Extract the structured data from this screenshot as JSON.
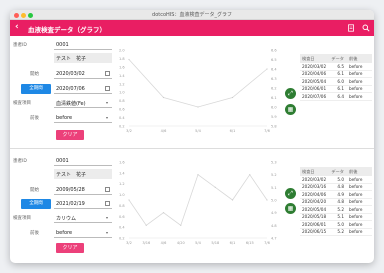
{
  "window": {
    "title": "dotcoHIS：血液検査データ_グラフ"
  },
  "appbar": {
    "back_icon": "chevron-left",
    "title": "血液検査データ（グラフ）",
    "icon1": "document-icon",
    "icon2": "zoom-icon"
  },
  "labels": {
    "patient_id": "患者ID",
    "start": "開始",
    "end_btn": "全期間",
    "item": "検査項目",
    "timing": "前後",
    "clear": "クリア"
  },
  "panel1": {
    "patient_id": "0001",
    "patient_name": "テスト　花子",
    "start_date": "2020/03/02",
    "end_date": "2020/07/06",
    "item": "血清鉄値(Fe)",
    "timing": "before",
    "chart_data": {
      "type": "line",
      "x": [
        "3/2",
        "4/6",
        "5/4",
        "6/1",
        "7/6"
      ],
      "y": [
        6.5,
        6.1,
        6.0,
        6.1,
        6.4
      ],
      "left_ticks": [
        "2.0",
        "1.8",
        "1.6",
        "1.4",
        "1.2",
        "1.0",
        "0.8",
        "0.6",
        "0.4",
        "0.2"
      ],
      "right_ticks": [
        "6.6",
        "6.5",
        "6.4",
        "6.3",
        "6.2",
        "6.1",
        "6.0",
        "5.9",
        "5.8"
      ],
      "x_ticks": [
        "3/2",
        "4/6",
        "5/4",
        "6/1",
        "7/6"
      ],
      "ylim": [
        5.8,
        6.6
      ]
    },
    "table": {
      "headers": [
        "検査日",
        "データ",
        "前後"
      ],
      "rows": [
        [
          "2020/03/02",
          "6.5",
          "before"
        ],
        [
          "2020/04/06",
          "6.1",
          "before"
        ],
        [
          "2020/05/04",
          "6.0",
          "before"
        ],
        [
          "2020/06/01",
          "6.1",
          "before"
        ],
        [
          "2020/07/06",
          "6.4",
          "before"
        ]
      ]
    }
  },
  "panel2": {
    "patient_id": "0001",
    "patient_name": "テスト　花子",
    "start_date": "2009/05/28",
    "end_date": "2021/02/19",
    "item": "カリウム",
    "timing": "before",
    "chart_data": {
      "type": "line",
      "x": [
        "3/2",
        "3/16",
        "4/6",
        "4/20",
        "5/4",
        "5/18",
        "6/1",
        "6/15",
        "7/6"
      ],
      "y": [
        5.0,
        4.8,
        4.9,
        4.8,
        5.2,
        5.1,
        5.0,
        5.2,
        5.0
      ],
      "left_ticks": [
        "1.6",
        "1.4",
        "1.2",
        "1.0",
        "0.8",
        "0.6",
        "0.4",
        "0.2"
      ],
      "right_ticks": [
        "5.3",
        "5.2",
        "5.1",
        "5.0",
        "4.9",
        "4.8",
        "4.7"
      ],
      "x_ticks": [
        "3/2",
        "3/16",
        "4/6",
        "4/20",
        "5/4",
        "5/18",
        "6/1",
        "6/15",
        "7/6"
      ],
      "ylim": [
        4.7,
        5.3
      ]
    },
    "table": {
      "headers": [
        "検査日",
        "データ",
        "前後"
      ],
      "rows": [
        [
          "2020/03/02",
          "5.0",
          "before"
        ],
        [
          "2020/03/16",
          "4.8",
          "before"
        ],
        [
          "2020/04/06",
          "4.9",
          "before"
        ],
        [
          "2020/04/20",
          "4.8",
          "before"
        ],
        [
          "2020/05/04",
          "5.2",
          "before"
        ],
        [
          "2020/05/18",
          "5.1",
          "before"
        ],
        [
          "2020/06/01",
          "5.0",
          "before"
        ],
        [
          "2020/06/15",
          "5.2",
          "before"
        ]
      ]
    }
  }
}
